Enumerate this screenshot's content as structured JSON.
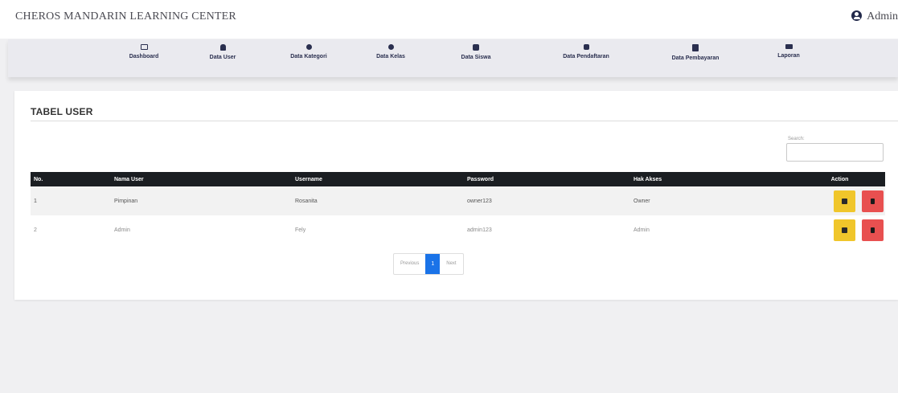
{
  "header": {
    "brand": "CHEROS MANDARIN LEARNING CENTER",
    "user_label": "Admin",
    "user_icon": "user-circle-icon"
  },
  "nav": {
    "items": [
      {
        "label": "Dashboard",
        "icon": "monitor-icon"
      },
      {
        "label": "Data User",
        "icon": "user-icon"
      },
      {
        "label": "Data Kategori",
        "icon": "tag-icon"
      },
      {
        "label": "Data Kelas",
        "icon": "class-icon"
      },
      {
        "label": "Data Siswa",
        "icon": "student-icon"
      },
      {
        "label": "Data Pendaftaran",
        "icon": "register-icon"
      },
      {
        "label": "Data Pembayaran",
        "icon": "payment-icon"
      },
      {
        "label": "Laporan",
        "icon": "report-icon"
      }
    ]
  },
  "main": {
    "title": "TABEL USER",
    "search": {
      "label": "Search:",
      "value": "",
      "placeholder": ""
    },
    "table": {
      "headers": [
        "No.",
        "Nama User",
        "Username",
        "Password",
        "Hak Akses",
        "Action"
      ],
      "rows": [
        {
          "no": "1",
          "nama": "Pimpinan",
          "username": "Rosanita",
          "password": "owner123",
          "hak": "Owner"
        },
        {
          "no": "2",
          "nama": "Admin",
          "username": "Fely",
          "password": "admin123",
          "hak": "Admin"
        }
      ],
      "action_icons": {
        "edit": "edit-icon",
        "delete": "trash-icon"
      }
    },
    "pagination": {
      "previous": "Previous",
      "current": "1",
      "next": "Next"
    }
  },
  "colors": {
    "table_header": "#1b1e22",
    "edit_button": "#f0c62b",
    "delete_button": "#e85050",
    "page_active": "#1a73e8",
    "nav_background": "#eaeaef"
  }
}
